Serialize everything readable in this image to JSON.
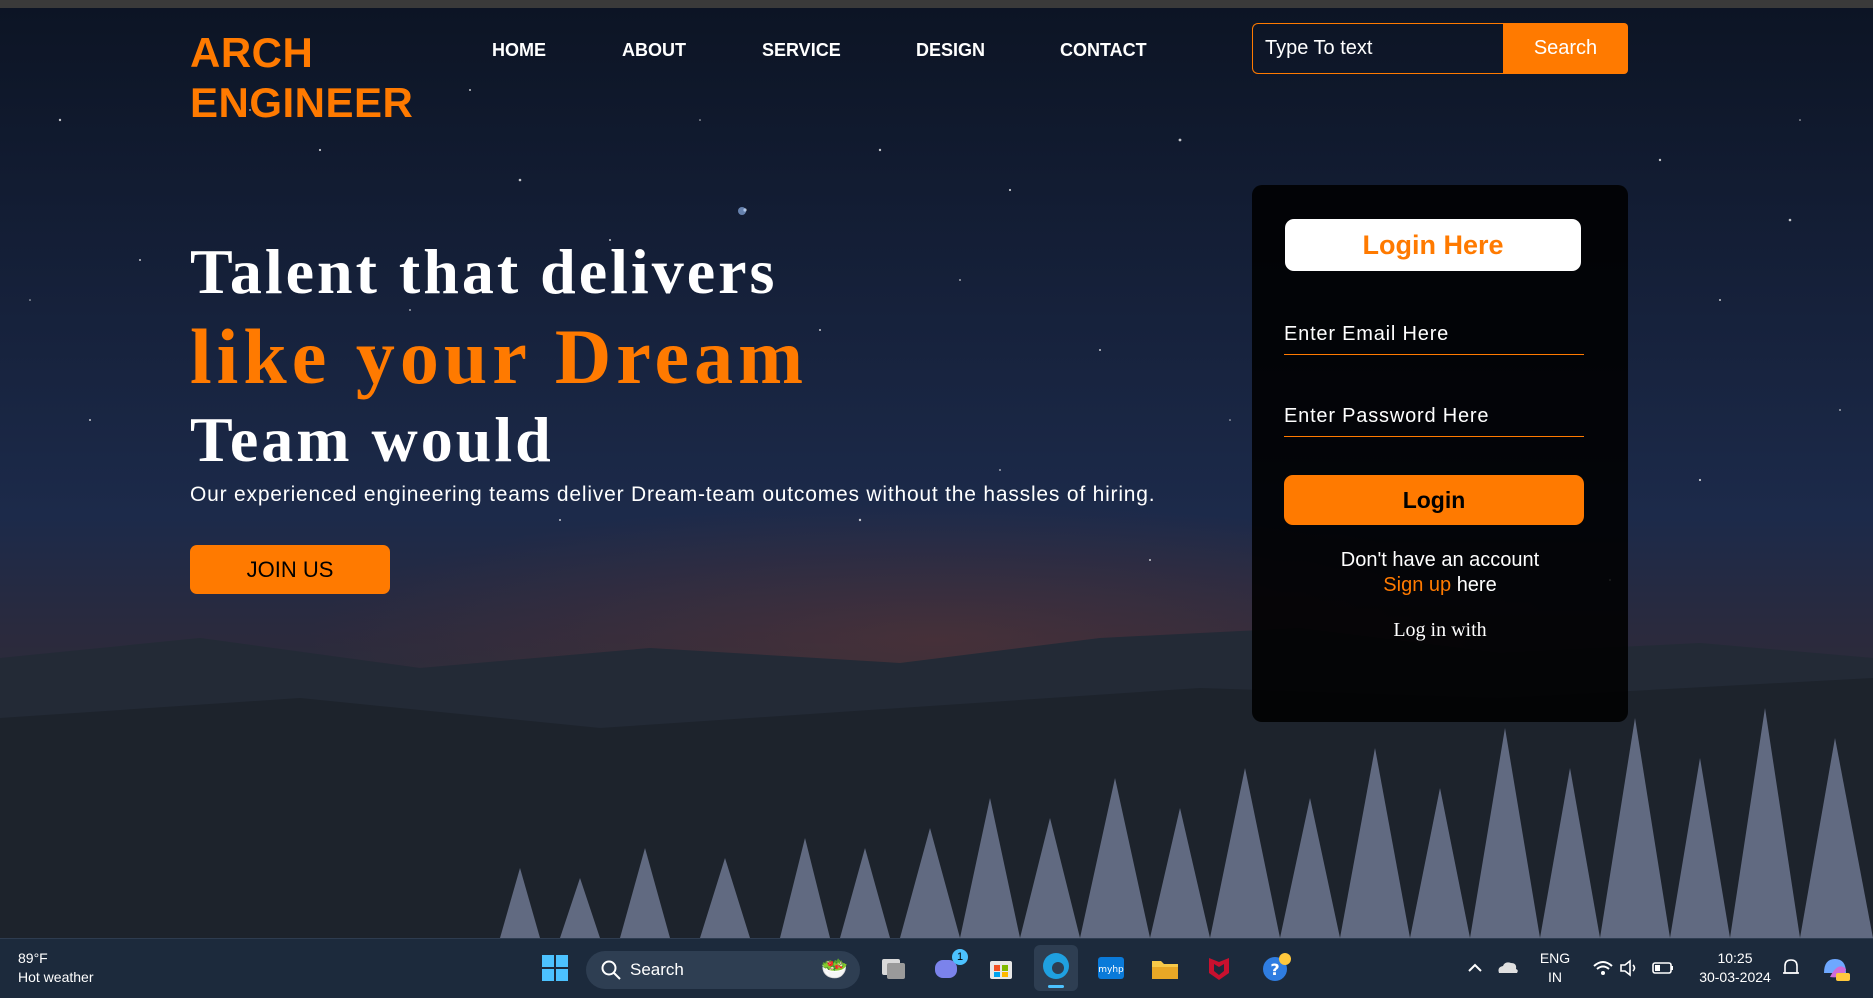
{
  "brand": {
    "line1": "ARCH",
    "line2": "ENGINEER"
  },
  "nav": [
    "HOME",
    "ABOUT",
    "SERVICE",
    "DESIGN",
    "CONTACT"
  ],
  "search": {
    "placeholder": "Type To text",
    "button": "Search"
  },
  "hero": {
    "line1": "Talent that delivers",
    "line2": "like your Dream",
    "line3": "Team would",
    "subtitle": "Our experienced engineering teams deliver Dream-team outcomes without the hassles of hiring.",
    "cta": "JOIN US"
  },
  "login": {
    "title": "Login Here",
    "email_placeholder": "Enter Email Here",
    "password_placeholder": "Enter Password Here",
    "button": "Login",
    "no_account": "Don't have an account",
    "signup_link": "Sign up",
    "signup_suffix": "here",
    "log_in_with": "Log in with"
  },
  "taskbar": {
    "weather_temp": "89°F",
    "weather_desc": "Hot weather",
    "search_label": "Search",
    "lang_line1": "ENG",
    "lang_line2": "IN",
    "time": "10:25",
    "date": "30-03-2024",
    "teams_badge": "1"
  },
  "colors": {
    "accent": "#ff7a00",
    "card": "#000000",
    "taskbar": "#1c2a3c"
  }
}
